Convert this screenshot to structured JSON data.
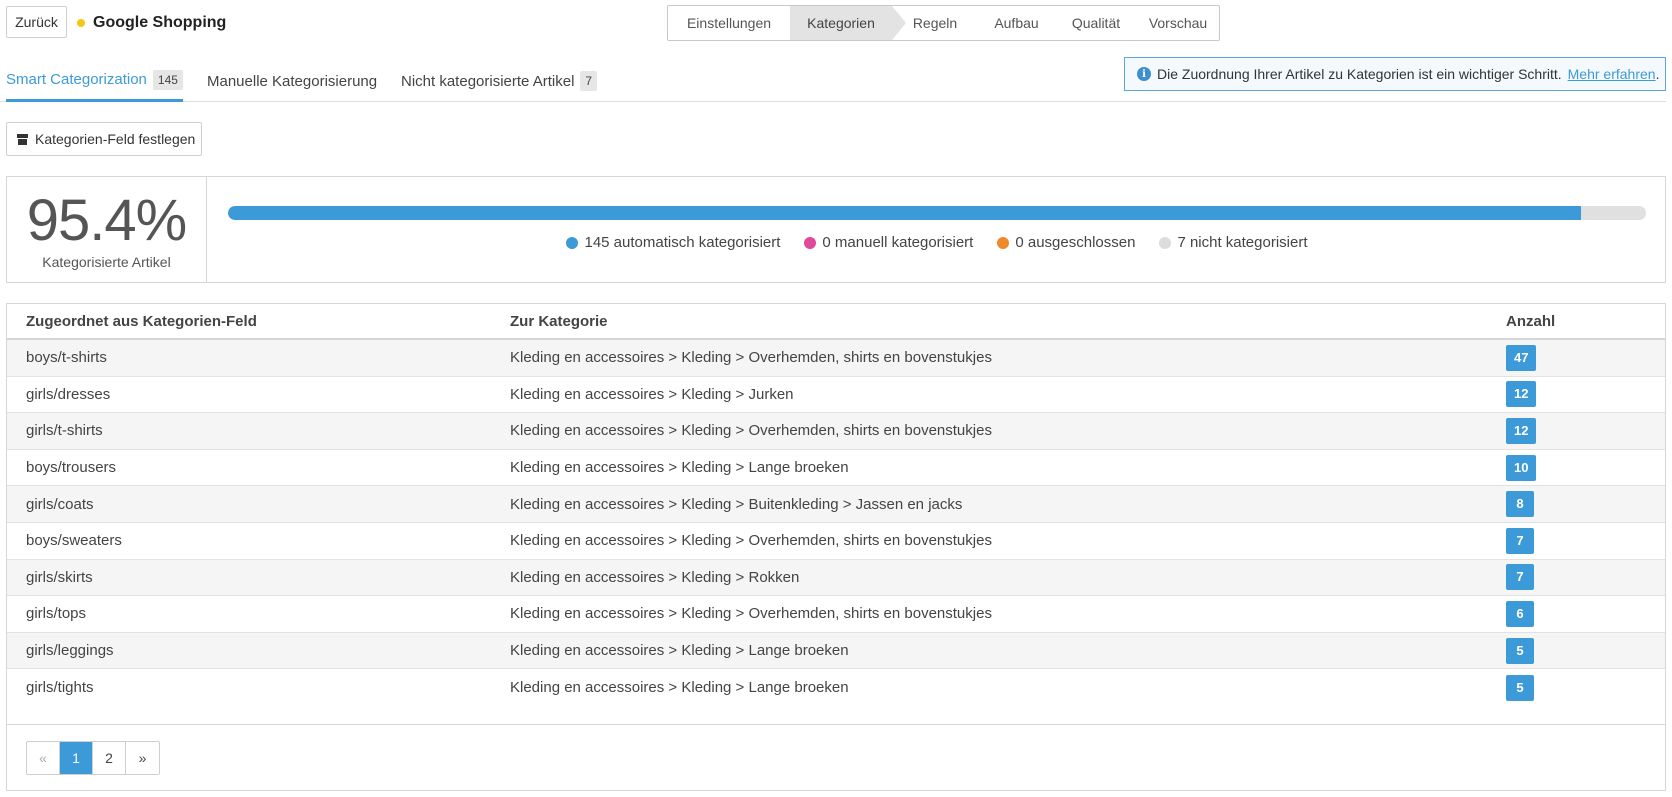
{
  "header": {
    "back_label": "Zurück",
    "app_title": "Google Shopping",
    "status_color": "#f5c518"
  },
  "wizard": {
    "steps": [
      {
        "label": "Einstellungen"
      },
      {
        "label": "Kategorien",
        "active": true
      },
      {
        "label": "Regeln"
      },
      {
        "label": "Aufbau"
      },
      {
        "label": "Qualität"
      },
      {
        "label": "Vorschau"
      }
    ]
  },
  "tabs": [
    {
      "label": "Smart Categorization",
      "badge": "145",
      "active": true
    },
    {
      "label": "Manuelle Kategorisierung",
      "badge": ""
    },
    {
      "label": "Nicht kategorisierte Artikel",
      "badge": "7"
    }
  ],
  "info": {
    "icon": "info-icon",
    "text": "Die Zuordnung Ihrer Artikel zu Kategorien ist ein wichtiger Schritt.",
    "link": "Mehr erfahren",
    "suffix": "."
  },
  "toolbar": {
    "set_field_label": "Kategorien-Feld festlegen",
    "set_field_icon": "archive-icon"
  },
  "stats": {
    "percent": "95.4%",
    "caption": "Kategorisierte Artikel",
    "progress_fraction": 0.954,
    "legend": [
      {
        "label": "145 automatisch kategorisiert",
        "color": "#3d9ad8"
      },
      {
        "label": "0 manuell kategorisiert",
        "color": "#e0489a"
      },
      {
        "label": "0 ausgeschlossen",
        "color": "#ee8a2b"
      },
      {
        "label": "7 nicht kategorisiert",
        "color": "#dcdcdc"
      }
    ]
  },
  "table": {
    "headers": {
      "source": "Zugeordnet aus Kategorien-Feld",
      "target": "Zur Kategorie",
      "count": "Anzahl"
    },
    "rows": [
      {
        "source": "boys/t-shirts",
        "target": "Kleding en accessoires > Kleding > Overhemden, shirts en bovenstukjes",
        "count": "47"
      },
      {
        "source": "girls/dresses",
        "target": "Kleding en accessoires > Kleding > Jurken",
        "count": "12"
      },
      {
        "source": "girls/t-shirts",
        "target": "Kleding en accessoires > Kleding > Overhemden, shirts en bovenstukjes",
        "count": "12"
      },
      {
        "source": "boys/trousers",
        "target": "Kleding en accessoires > Kleding > Lange broeken",
        "count": "10"
      },
      {
        "source": "girls/coats",
        "target": "Kleding en accessoires > Kleding > Buitenkleding > Jassen en jacks",
        "count": "8"
      },
      {
        "source": "boys/sweaters",
        "target": "Kleding en accessoires > Kleding > Overhemden, shirts en bovenstukjes",
        "count": "7"
      },
      {
        "source": "girls/skirts",
        "target": "Kleding en accessoires > Kleding > Rokken",
        "count": "7"
      },
      {
        "source": "girls/tops",
        "target": "Kleding en accessoires > Kleding > Overhemden, shirts en bovenstukjes",
        "count": "6"
      },
      {
        "source": "girls/leggings",
        "target": "Kleding en accessoires > Kleding > Lange broeken",
        "count": "5"
      },
      {
        "source": "girls/tights",
        "target": "Kleding en accessoires > Kleding > Lange broeken",
        "count": "5"
      }
    ]
  },
  "pagination": {
    "prev": "«",
    "pages": [
      "1",
      "2"
    ],
    "current": "1",
    "next": "»"
  }
}
